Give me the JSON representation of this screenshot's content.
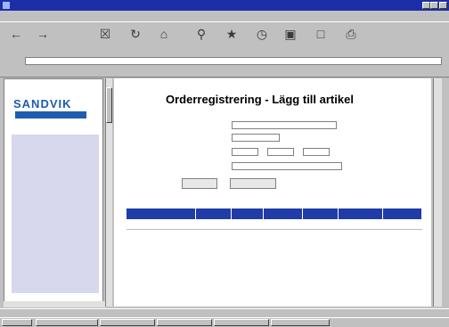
{
  "window": {
    "title": ""
  },
  "menu": [
    {
      "label": ""
    },
    {
      "label": ""
    },
    {
      "label": ""
    },
    {
      "label": ""
    },
    {
      "label": ""
    },
    {
      "label": ""
    }
  ],
  "toolbar": [
    {
      "label": "",
      "icon": "back-icon"
    },
    {
      "label": "",
      "icon": "forward-icon"
    },
    {
      "label": "",
      "icon": "stop-icon"
    },
    {
      "label": "",
      "icon": "refresh-icon"
    },
    {
      "label": "",
      "icon": "home-icon"
    },
    {
      "label": "",
      "icon": "search-icon"
    },
    {
      "label": "",
      "icon": "favorites-icon"
    },
    {
      "label": "",
      "icon": "history-icon"
    },
    {
      "label": "",
      "icon": "channels-icon"
    },
    {
      "label": "",
      "icon": "fullscreen-icon"
    },
    {
      "label": "",
      "icon": "print-icon"
    }
  ],
  "address": {
    "label": "",
    "value": ""
  },
  "links": {
    "label": "",
    "items": [
      {
        "label": ""
      },
      {
        "label": ""
      },
      {
        "label": ""
      },
      {
        "label": ""
      },
      {
        "label": ""
      }
    ]
  },
  "left": {
    "logo_name": "SANDVIK",
    "logo_sub": "",
    "logo_return": "",
    "sections": [
      {
        "title": "",
        "items": [
          "",
          ""
        ]
      },
      {
        "title": "",
        "items": [
          "",
          "",
          ""
        ]
      },
      {
        "title": "",
        "items": [
          "",
          "",
          ""
        ]
      },
      {
        "title": "",
        "items": []
      }
    ]
  },
  "page": {
    "title": "Orderregistrering - Lägg till artikel",
    "form": {
      "article_label": "",
      "quantity_label": "",
      "delivery_label": "",
      "delivery_hint": "",
      "comment_label": ""
    },
    "buttons": {
      "add": "",
      "search": "",
      "help": ""
    },
    "table": {
      "headers": [
        "",
        "",
        "",
        "",
        "",
        "",
        ""
      ],
      "rows": [
        {
          "cells": [
            "",
            "",
            "",
            "",
            "",
            "",
            ""
          ]
        }
      ]
    },
    "footer_links": [
      "",
      "",
      "",
      ""
    ]
  },
  "status": {
    "text": ""
  },
  "taskbar": {
    "start": "",
    "tasks": [
      {
        "label": ""
      },
      {
        "label": ""
      },
      {
        "label": ""
      },
      {
        "label": ""
      },
      {
        "label": ""
      }
    ]
  }
}
